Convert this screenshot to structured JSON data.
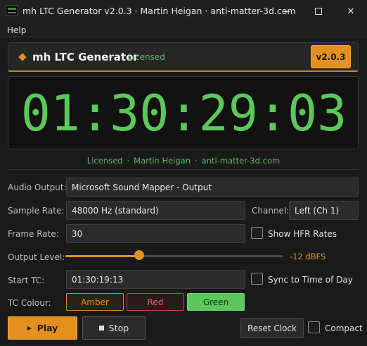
{
  "window": {
    "title": "mh LTC Generator  v2.0.3  ·  Martin Heigan  ·  anti-matter-3d.com",
    "controls": {
      "minimize": "—",
      "maximize": "",
      "close": "✕"
    }
  },
  "menu": {
    "help": "Help"
  },
  "header": {
    "title": "mh LTC Generator",
    "licensed": "Licensed",
    "version": "v2.0.3"
  },
  "timecode": {
    "display": "01:30:29:03"
  },
  "license_line": {
    "licensed": "Licensed",
    "author": "Martin Heigan",
    "site": "anti-matter-3d.com",
    "separator": "·"
  },
  "form": {
    "audio_output": {
      "label": "Audio Output:",
      "value": "Microsoft Sound Mapper - Output"
    },
    "sample_rate": {
      "label": "Sample Rate:",
      "value": "48000 Hz  (standard)"
    },
    "channel": {
      "label": "Channel:",
      "value": "Left  (Ch 1)"
    },
    "frame_rate": {
      "label": "Frame Rate:",
      "value": "30"
    },
    "show_hfr": {
      "label": "Show HFR Rates",
      "checked": false
    },
    "output_level": {
      "label": "Output Level:",
      "value_text": "-12 dBFS",
      "fraction": 0.34
    },
    "start_tc": {
      "label": "Start TC:",
      "value": "01:30:19:13"
    },
    "sync_tod": {
      "label": "Sync to Time of Day",
      "checked": false
    },
    "tc_colour": {
      "label": "TC Colour:",
      "options": [
        "Amber",
        "Red",
        "Green"
      ],
      "selected": "Green"
    }
  },
  "actions": {
    "play": "Play",
    "stop": "Stop",
    "reset_clock": "Reset Clock",
    "compact": {
      "label": "Compact",
      "checked": false
    }
  },
  "colors": {
    "accent_amber": "#e3901f",
    "tc_green": "#5cc85c",
    "red": "#e06060",
    "background": "#1a1a1a"
  }
}
